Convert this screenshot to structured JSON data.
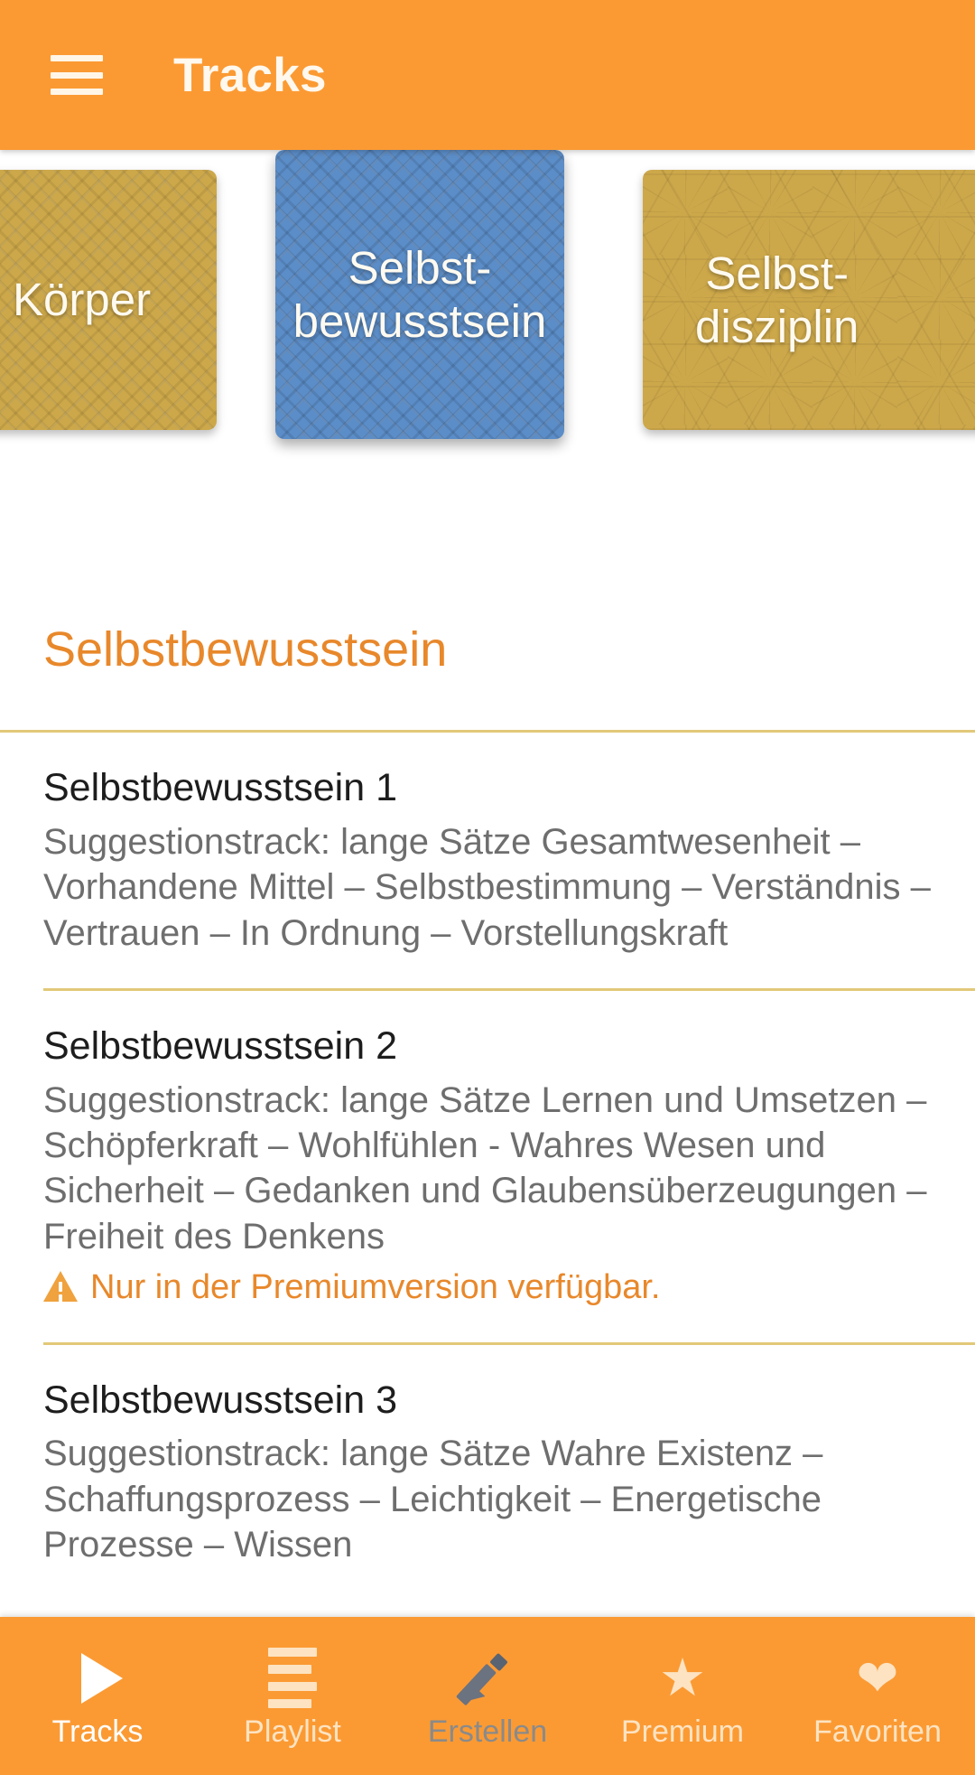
{
  "appbar": {
    "menu_icon": "hamburger-menu-icon",
    "title": "Tracks"
  },
  "carousel": {
    "cards": [
      {
        "label": "Körper",
        "color": "#CDA84A",
        "pattern": "maze",
        "selected": false
      },
      {
        "label": "Selbst-\nbewusstsein",
        "line1": "Selbst-",
        "line2": "bewusstsein",
        "color": "#5B8DC8",
        "pattern": "maze",
        "selected": true
      },
      {
        "label": "Selbst-\ndisziplin",
        "line1": "Selbst-",
        "line2": "disziplin",
        "color": "#CDA84A",
        "pattern": "asanoha-star",
        "selected": false
      }
    ]
  },
  "section": {
    "heading": "Selbstbewusstsein",
    "heading_color": "#E8882B",
    "divider_color": "#E2C979"
  },
  "tracks": [
    {
      "title": "Selbstbewusstsein 1",
      "description": "Suggestionstrack: lange Sätze Gesamtwesenheit – Vorhandene Mittel – Selbstbestimmung – Verständnis – Vertrauen – In Ordnung – Vorstellungskraft",
      "premium_note": null
    },
    {
      "title": "Selbstbewusstsein 2",
      "description": "Suggestionstrack: lange Sätze Lernen und Umsetzen – Schöpferkraft – Wohlfühlen - Wahres Wesen und Sicherheit – Gedanken und Glaubensüberzeugungen – Freiheit des Denkens",
      "premium_note": "Nur in der Premiumversion verfügbar.",
      "premium_icon": "warning-triangle-icon"
    },
    {
      "title": "Selbstbewusstsein 3",
      "description": "Suggestionstrack: lange Sätze Wahre Existenz – Schaffungsprozess – Leichtigkeit – Energetische Prozesse – Wissen",
      "premium_note": null
    }
  ],
  "bottom_nav": {
    "background": "#FB9A33",
    "items": [
      {
        "label": "Tracks",
        "icon": "play-icon",
        "state": "active"
      },
      {
        "label": "Playlist",
        "icon": "list-icon",
        "state": "normal"
      },
      {
        "label": "Erstellen",
        "icon": "pencil-icon",
        "state": "dim"
      },
      {
        "label": "Premium",
        "icon": "star-icon",
        "state": "normal"
      },
      {
        "label": "Favoriten",
        "icon": "heart-icon",
        "state": "normal"
      }
    ]
  }
}
